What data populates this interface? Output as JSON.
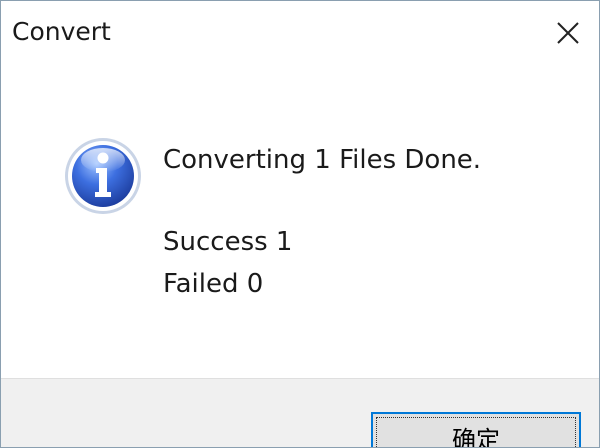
{
  "window": {
    "title": "Convert"
  },
  "message": {
    "main": "Converting 1 Files Done.",
    "success": "Success 1",
    "failed": "Failed 0"
  },
  "buttons": {
    "ok_label": "确定"
  },
  "icons": {
    "close": "close-icon",
    "info": "info-icon"
  },
  "colors": {
    "focus_border": "#0078d7",
    "footer_bg": "#f0f0f0",
    "info_icon_blue": "#2a52be"
  }
}
